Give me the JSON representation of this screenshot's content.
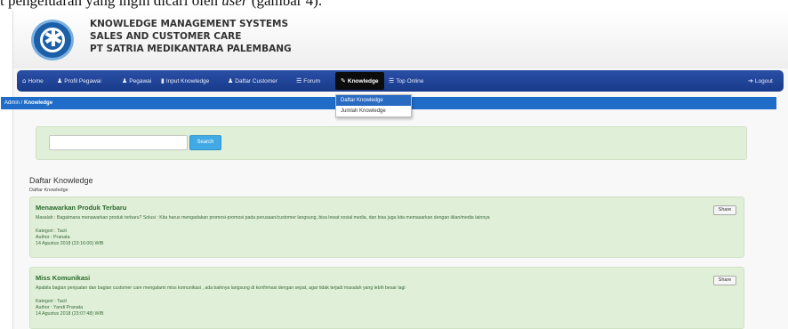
{
  "doc_fragment": {
    "text": "t pengeluaran yang ingin dicari oleh",
    "italic": "user",
    "tail": "(gambar 4)."
  },
  "app": {
    "title_lines": [
      "KNOWLEDGE MANAGEMENT SYSTEMS",
      "SALES AND CUSTOMER CARE",
      "PT SATRIA MEDIKANTARA PALEMBANG"
    ]
  },
  "nav": {
    "items": [
      {
        "label": "Home",
        "icon": "home-icon",
        "glyph": "⌂"
      },
      {
        "label": "Profil Pegawai",
        "icon": "user-icon",
        "glyph": "♟"
      },
      {
        "label": "Pegawai",
        "icon": "user-icon",
        "glyph": "♟"
      },
      {
        "label": "Input Knowledge",
        "icon": "book-icon",
        "glyph": "▮"
      },
      {
        "label": "Daftar Customer",
        "icon": "user-icon",
        "glyph": "♟"
      },
      {
        "label": "Forum",
        "icon": "list-icon",
        "glyph": "☰"
      },
      {
        "label": "Knowledge",
        "icon": "pen-icon",
        "glyph": "✎"
      },
      {
        "label": "Top Online",
        "icon": "list-icon",
        "glyph": "☰"
      }
    ],
    "logout": {
      "label": "Logout",
      "icon": "logout-icon",
      "glyph": "➔"
    }
  },
  "dropdown": {
    "items": [
      "Daftar Knowledge",
      "Jumlah Knowledge"
    ]
  },
  "breadcrumb": {
    "root": "Admin",
    "separator": " / ",
    "current": "Knowledge"
  },
  "search": {
    "value": "",
    "button": "Search"
  },
  "section": {
    "title": "Daftar Knowledge",
    "subtitle": "Daftar Knowledge"
  },
  "cards": [
    {
      "title": "Menawarkan Produk Terbaru",
      "text": "Masalah : Bagaimana menawarkan produk terbaru? Solusi : Kita harus mengadakan promosi-promosi pada perusaan/customer langsung, bisa lewat sosial media, dan bisa juga kita memasarkan dengan iklan/media lainnya",
      "kategori": "Kategori : Tacit",
      "author": "Author : Pranata",
      "date": "14 Agustus 2018 (23:16:00) WIB",
      "share": "Share"
    },
    {
      "title": "Miss Komunikasi",
      "text": "Apabila bagian penjualan dan bagian customer care mengalami miss komunikasi , ada baiknya langsung di konfirmasi dengan sepat, agar tidak terjadi masalah yang lebih besar lagi",
      "kategori": "Kategori : Tacit",
      "author": "Author : Yandi Pranata",
      "date": "14 Agustus 2018 (23:07:48) WIB",
      "share": "Share"
    }
  ],
  "colors": {
    "navbar": "#1f4497",
    "breadcrumb": "#1f6cc9",
    "card_bg": "#e0efd8",
    "search_button": "#41a9e3"
  }
}
